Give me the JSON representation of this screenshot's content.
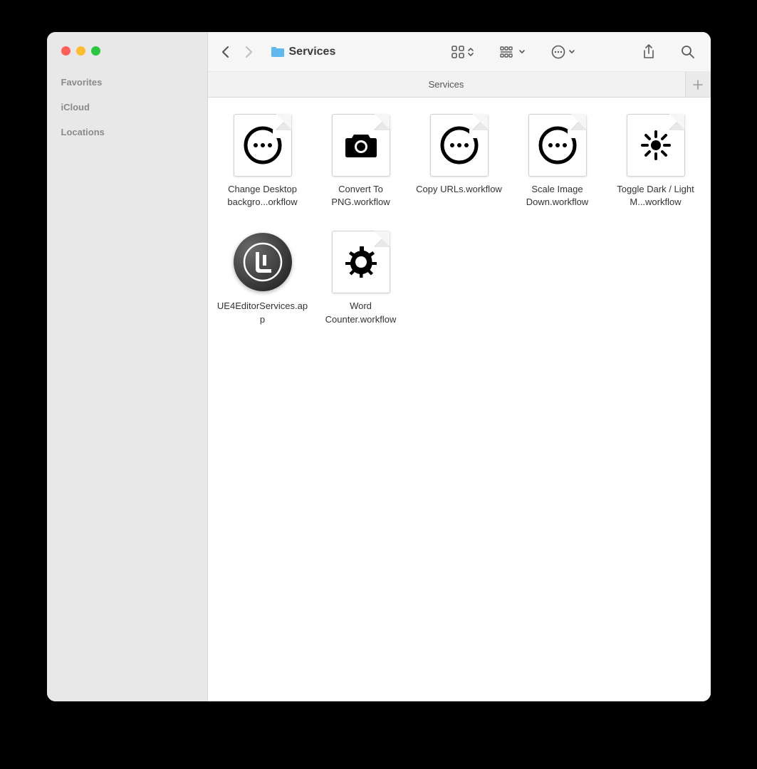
{
  "window": {
    "title": "Services"
  },
  "sidebar": {
    "sections": [
      {
        "label": "Favorites"
      },
      {
        "label": "iCloud"
      },
      {
        "label": "Locations"
      }
    ]
  },
  "tab": {
    "label": "Services"
  },
  "files": [
    {
      "name": "Change Desktop backgro...orkflow",
      "icon": "ellipsis"
    },
    {
      "name": "Convert To PNG.workflow",
      "icon": "camera"
    },
    {
      "name": "Copy URLs.workflow",
      "icon": "ellipsis"
    },
    {
      "name": "Scale Image Down.workflow",
      "icon": "ellipsis"
    },
    {
      "name": "Toggle Dark / Light M...workflow",
      "icon": "brightness"
    },
    {
      "name": "UE4EditorServices.app",
      "icon": "unreal"
    },
    {
      "name": "Word Counter.workflow",
      "icon": "gear"
    }
  ]
}
